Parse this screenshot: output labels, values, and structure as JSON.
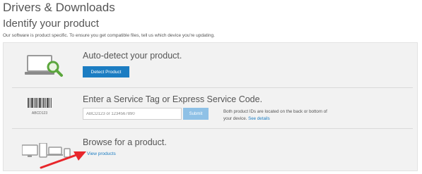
{
  "header": {
    "title": "Drivers & Downloads",
    "subtitle": "Identify your product",
    "intro": "Our software is product specific. To ensure you get compatible files, tell us which device you're updating."
  },
  "autodetect": {
    "heading": "Auto-detect your product.",
    "button_label": "Detect Product"
  },
  "service_tag": {
    "heading": "Enter a Service Tag or Express Service Code.",
    "input_placeholder": "ABCD123 or 1234567890",
    "submit_label": "Submit",
    "help_text": "Both product IDs are located on the back or bottom of your device.",
    "help_link": "See details",
    "barcode_text": "ABCD123"
  },
  "browse": {
    "heading": "Browse for a product.",
    "link_label": "View products"
  },
  "colors": {
    "accent": "#1c7dc2",
    "panel_bg": "#f2f2f2",
    "arrow": "#e8262b"
  },
  "icons": [
    "laptop-magnifier-icon",
    "barcode-icon",
    "devices-icon",
    "red-arrow-icon"
  ]
}
